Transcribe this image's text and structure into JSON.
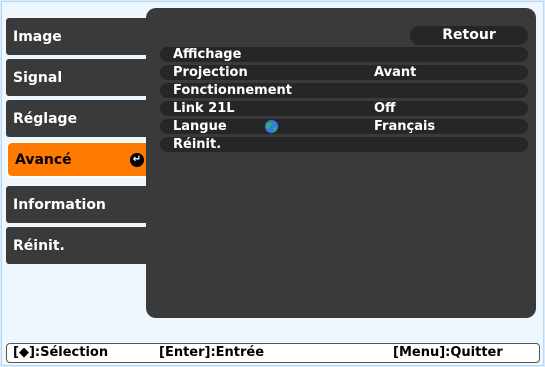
{
  "menu": {
    "tabs": [
      {
        "label": "Image",
        "active": false
      },
      {
        "label": "Signal",
        "active": false
      },
      {
        "label": "Réglage",
        "active": false
      },
      {
        "label": "Avancé",
        "active": true
      },
      {
        "label": "Information",
        "active": false
      },
      {
        "label": "Réinit.",
        "active": false
      }
    ]
  },
  "panel": {
    "back_label": "Retour",
    "rows": [
      {
        "label": "Affichage",
        "value": ""
      },
      {
        "label": "Projection",
        "value": "Avant"
      },
      {
        "label": "Fonctionnement",
        "value": ""
      },
      {
        "label": "Link 21L",
        "value": "Off"
      },
      {
        "label": "Langue",
        "value": "Français",
        "icon": "globe-icon"
      },
      {
        "label": "Réinit.",
        "value": ""
      }
    ]
  },
  "statusbar": {
    "select": "[◆]:Sélection",
    "enter": "[Enter]:Entrée",
    "quit": "[Menu]:Quitter"
  },
  "colors": {
    "tab_bg": "#3a3a3a",
    "active_tab_bg": "#ff7a00",
    "row_bg": "#262626",
    "background": "#d9ecfc"
  }
}
